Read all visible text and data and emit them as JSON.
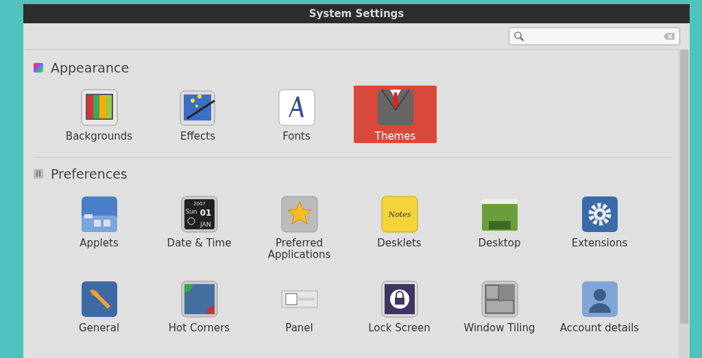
{
  "window": {
    "title": "System Settings"
  },
  "sections": [
    {
      "title": "Appearance",
      "kind": "appearance",
      "items": [
        {
          "label": "Backgrounds",
          "kind": "backgrounds",
          "selected": false
        },
        {
          "label": "Effects",
          "kind": "effects",
          "selected": false
        },
        {
          "label": "Fonts",
          "kind": "fonts",
          "selected": false
        },
        {
          "label": "Themes",
          "kind": "themes",
          "selected": true
        }
      ]
    },
    {
      "title": "Preferences",
      "kind": "preferences",
      "items": [
        {
          "label": "Applets",
          "kind": "applets",
          "selected": false
        },
        {
          "label": "Date & Time",
          "kind": "datetime",
          "selected": false,
          "icon_text": [
            "2007",
            "Sun",
            "01",
            "JAN"
          ]
        },
        {
          "label": "Preferred Applications",
          "kind": "star",
          "selected": false
        },
        {
          "label": "Desklets",
          "kind": "notes",
          "selected": false,
          "icon_text": [
            "Notes"
          ]
        },
        {
          "label": "Desktop",
          "kind": "desktop",
          "selected": false
        },
        {
          "label": "Extensions",
          "kind": "gear",
          "selected": false
        },
        {
          "label": "General",
          "kind": "wrench",
          "selected": false
        },
        {
          "label": "Hot Corners",
          "kind": "corners",
          "selected": false
        },
        {
          "label": "Panel",
          "kind": "panel",
          "selected": false
        },
        {
          "label": "Lock Screen",
          "kind": "lock",
          "selected": false
        },
        {
          "label": "Window Tiling",
          "kind": "tiling",
          "selected": false
        },
        {
          "label": "Account details",
          "kind": "user",
          "selected": false
        }
      ]
    }
  ]
}
